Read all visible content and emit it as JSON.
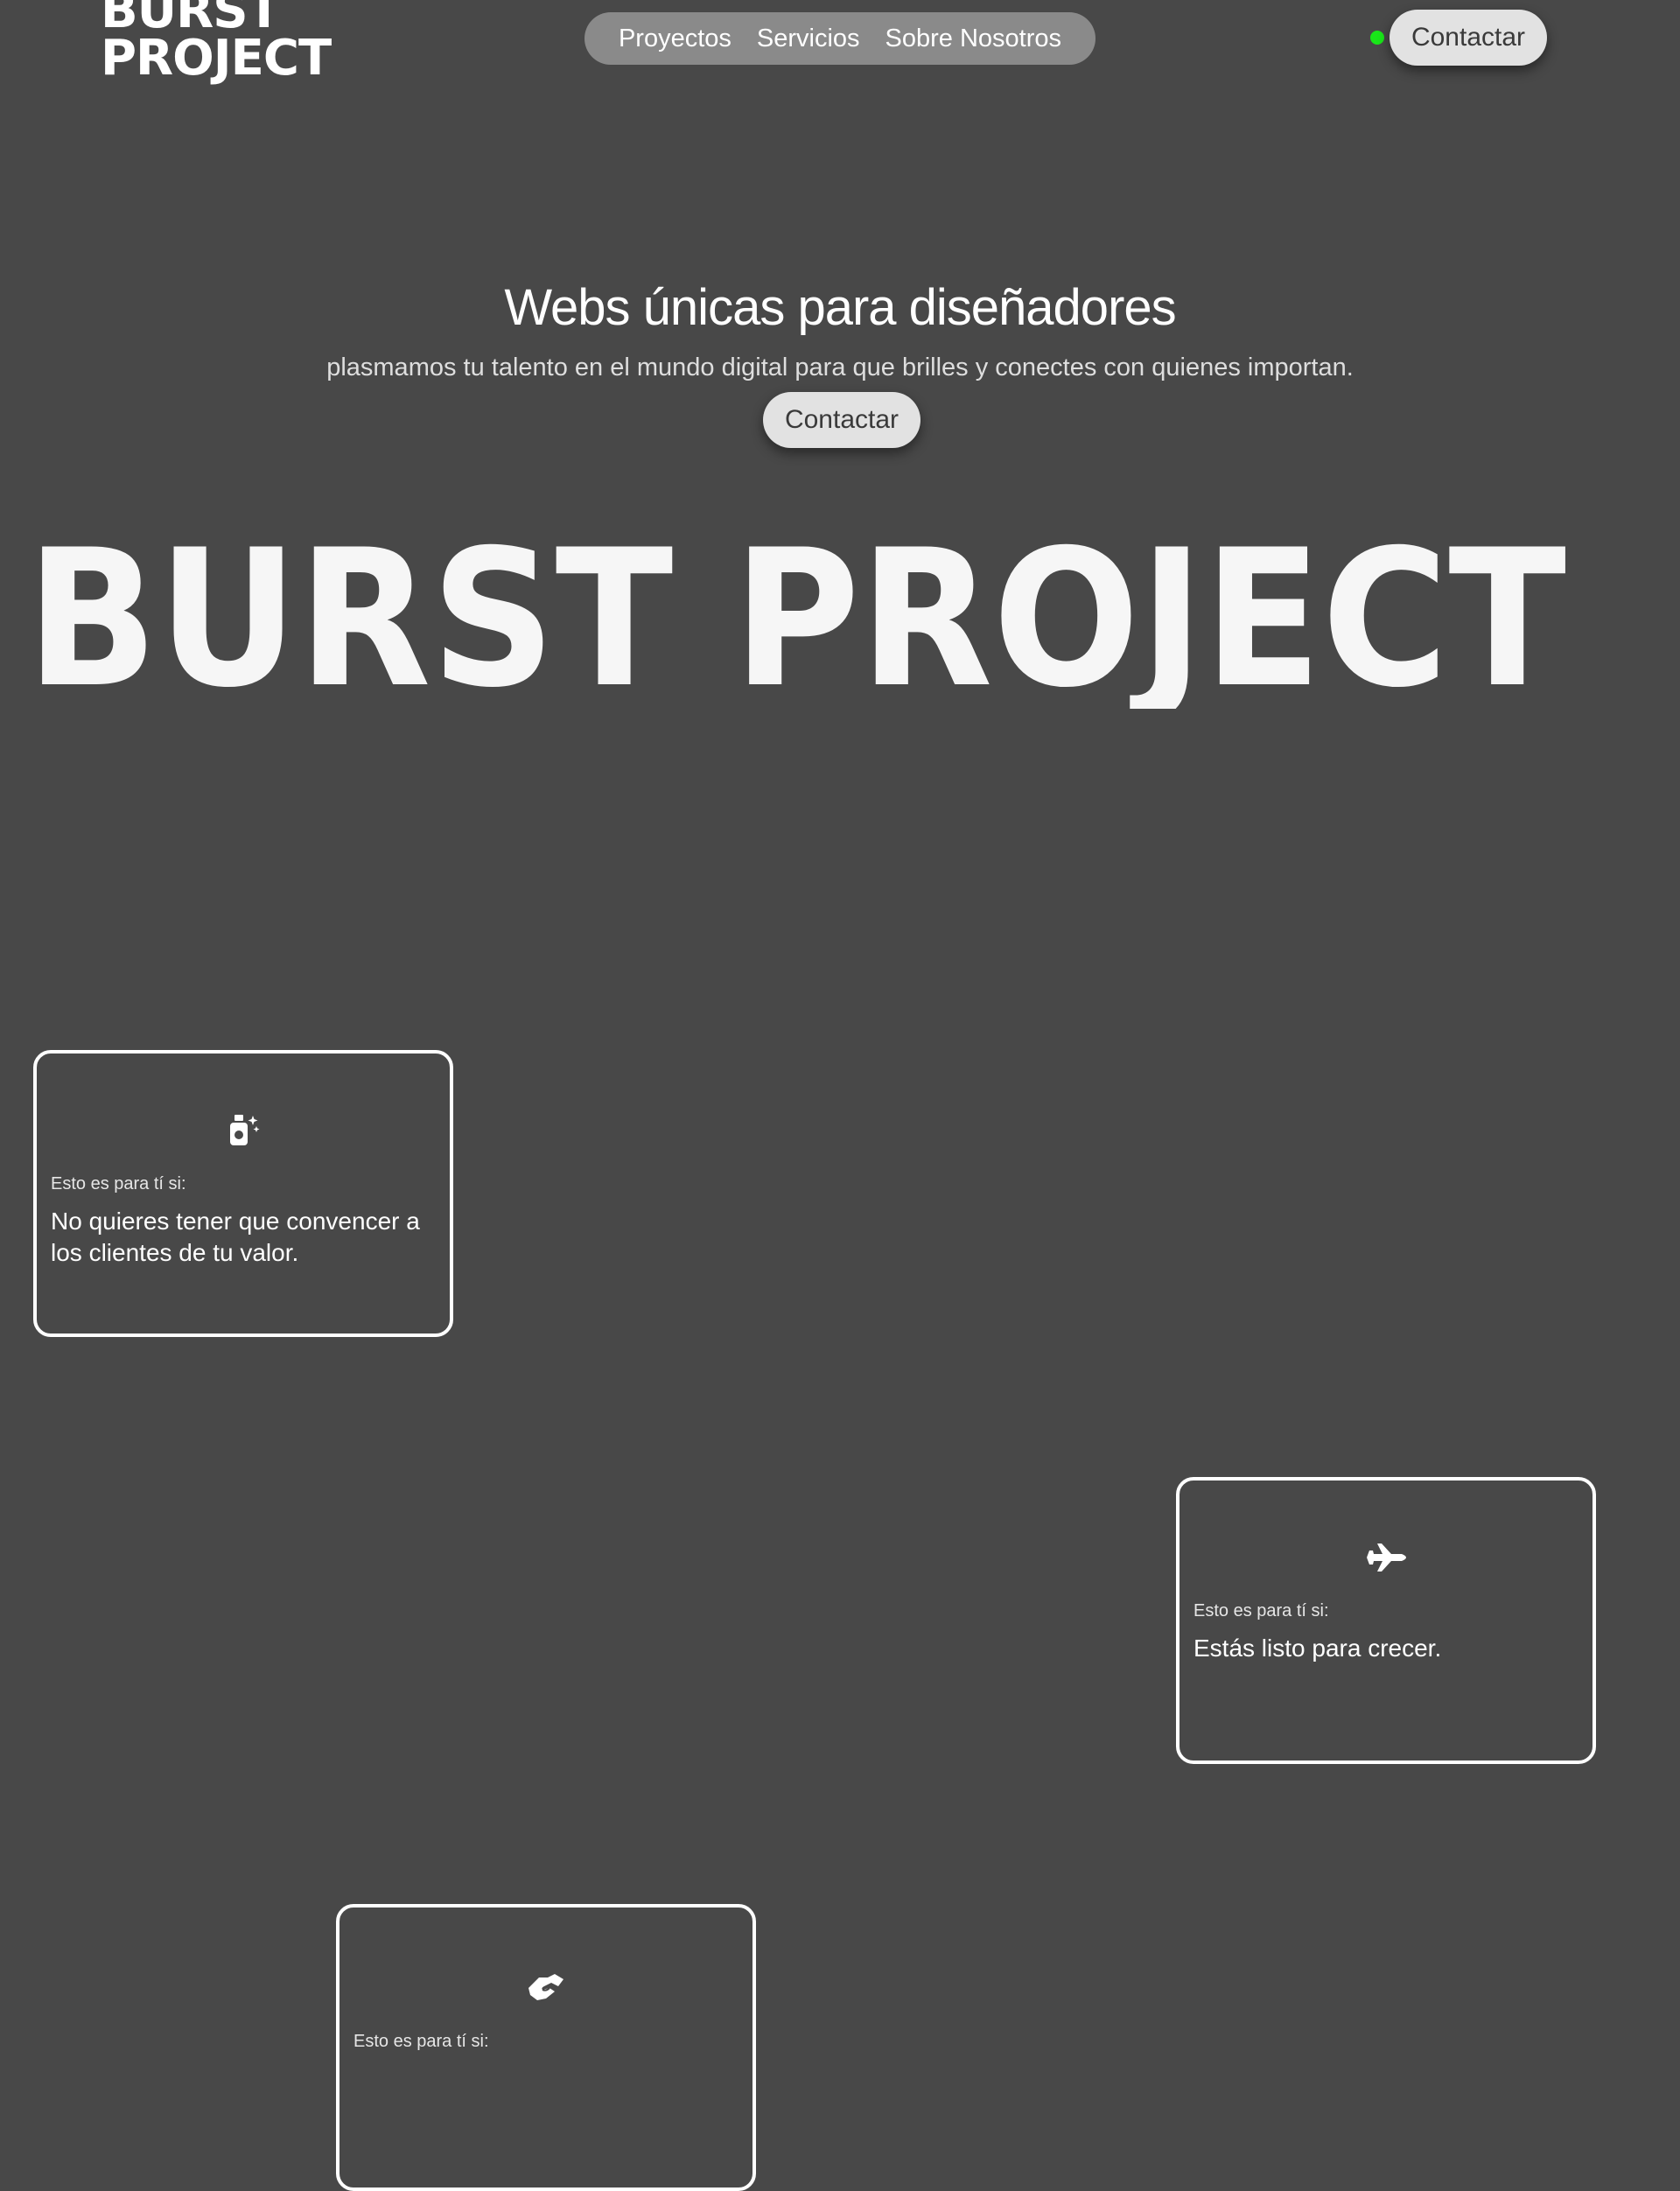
{
  "header": {
    "logo_line1": "BURST",
    "logo_line2": "PROJECT",
    "nav": [
      "Proyectos",
      "Servicios",
      "Sobre Nosotros"
    ],
    "contact_label": "Contactar",
    "status_color": "#19e619"
  },
  "hero": {
    "title": "Webs únicas para diseñadores",
    "subtitle": "plasmamos tu talento en el mundo digital para que brilles y conectes con quienes importan.",
    "contact_label": "Contactar",
    "wordmark": "BURST PROJECT"
  },
  "cards": [
    {
      "icon": "perfume-bottle-sparkles-icon",
      "kicker": "Esto es para tí si:",
      "text": "No quieres tener que convencer a los clientes de tu valor."
    },
    {
      "icon": "jet-plane-icon",
      "kicker": "Esto es para tí si:",
      "text": "Estás listo para crecer."
    },
    {
      "icon": "handshake-icon",
      "kicker": "Esto es para tí si:",
      "text": ""
    }
  ],
  "colors": {
    "background": "#484848",
    "nav_pill": "#8a8a8a",
    "button": "#e2e2e2",
    "text": "#ffffff"
  }
}
